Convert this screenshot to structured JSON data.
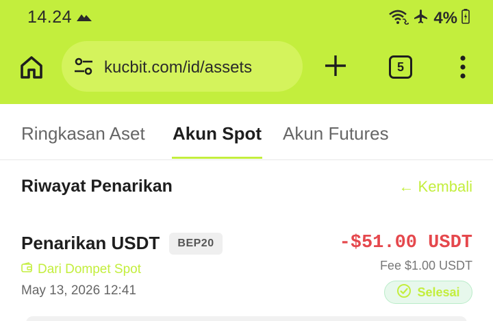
{
  "status_bar": {
    "time": "14.24",
    "battery": "4%",
    "icons": [
      "mountain-icon",
      "wifi-calling-icon",
      "airplane-icon",
      "battery-low-icon"
    ]
  },
  "browser": {
    "url": "kucbit.com/id/assets",
    "tab_count": "5",
    "icons": [
      "home-icon",
      "site-settings-icon",
      "plus-icon",
      "more-vert-icon"
    ]
  },
  "tabs": [
    {
      "label": "Ringkasan Aset",
      "active": false
    },
    {
      "label": "Akun Spot",
      "active": true
    },
    {
      "label": "Akun Futures",
      "active": false
    }
  ],
  "section": {
    "title": "Riwayat Penarikan",
    "back_label": "← Kembali"
  },
  "transactions": [
    {
      "title": "Penarikan USDT",
      "network": "BEP20",
      "source": "Dari Dompet Spot",
      "datetime": "May 13, 2026 12:41",
      "amount": "-$51.00 USDT",
      "fee": "Fee $1.00 USDT",
      "status": "Selesai"
    }
  ],
  "colors": {
    "accent": "#c3ee3d",
    "negative": "#e5484d",
    "success_bg": "#e7f8ec"
  }
}
